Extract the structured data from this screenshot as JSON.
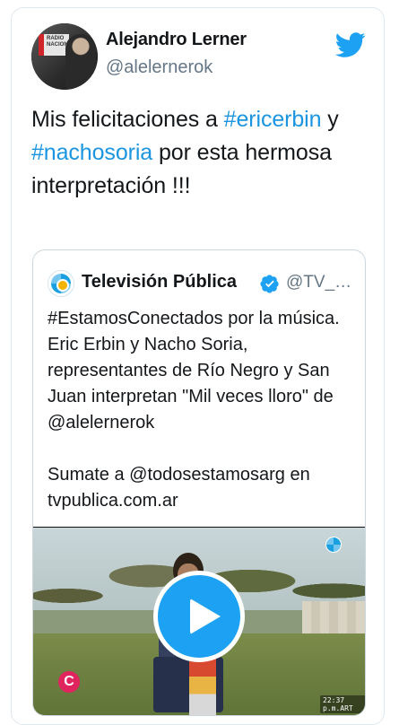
{
  "author": {
    "name": "Alejandro Lerner",
    "handle": "@alelernerok",
    "avatar_label": "RADIO NACIONAL"
  },
  "tweet": {
    "t1": "Mis felicitaciones a ",
    "tag1": "#ericerbin",
    "t2": " y ",
    "tag2": "#nachosoria",
    "t3": " por esta hermosa interpretación !!!"
  },
  "quoted": {
    "name": "Televisión Pública",
    "handle": "@TV_…",
    "line1": "#EstamosConectados por la música. Eric Erbin y Nacho Soria, representantes de Río Negro y San Juan interpretan \"Mil veces lloro\" de @alelernerok",
    "line2": "Sumate a @todosestamosarg en tvpublica.com.ar",
    "video_timestamp": "22:37 p.m.ART",
    "video_logo_letter": "C"
  },
  "colors": {
    "accent": "#1da1f2",
    "hashtag": "#1b95e0",
    "secondary_text": "#657786"
  },
  "icons": [
    "twitter-bird-icon",
    "verified-badge-icon",
    "play-icon"
  ]
}
